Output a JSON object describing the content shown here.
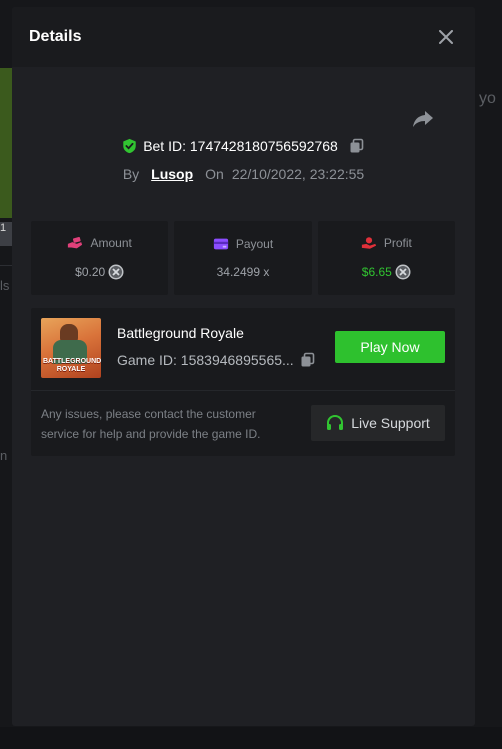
{
  "modal": {
    "title": "Details"
  },
  "bet": {
    "id_label": "Bet ID: 1747428180756592768",
    "by_label": "By",
    "user": "Lusop",
    "on_label": "On",
    "date": "22/10/2022, 23:22:55"
  },
  "stats": {
    "amount_label": "Amount",
    "amount_value": "$0.20",
    "payout_label": "Payout",
    "payout_value": "34.2499 x",
    "profit_label": "Profit",
    "profit_value": "$6.65"
  },
  "game": {
    "name": "Battleground Royale",
    "id_label": "Game ID: 1583946895565...",
    "thumb_text": "BATTLEGROUND ROYALE",
    "play_label": "Play Now"
  },
  "support": {
    "notice": "Any issues, please contact the customer service for help and provide the game ID.",
    "button_label": "Live Support"
  },
  "background": {
    "right_text": "yo",
    "left_text_1": "1",
    "left_text_2": "ls",
    "left_text_3": "n"
  },
  "colors": {
    "accent_green": "#2ec12e",
    "shield_green": "#31c431",
    "amount_icon": "#e0407a",
    "payout_icon": "#8b4dff",
    "profit_icon": "#e0303a"
  },
  "icons": {
    "close": "close-icon",
    "share": "share-icon",
    "shield": "shield-check-icon",
    "copy": "copy-icon",
    "coin": "coin-icon",
    "headset": "headset-icon"
  }
}
